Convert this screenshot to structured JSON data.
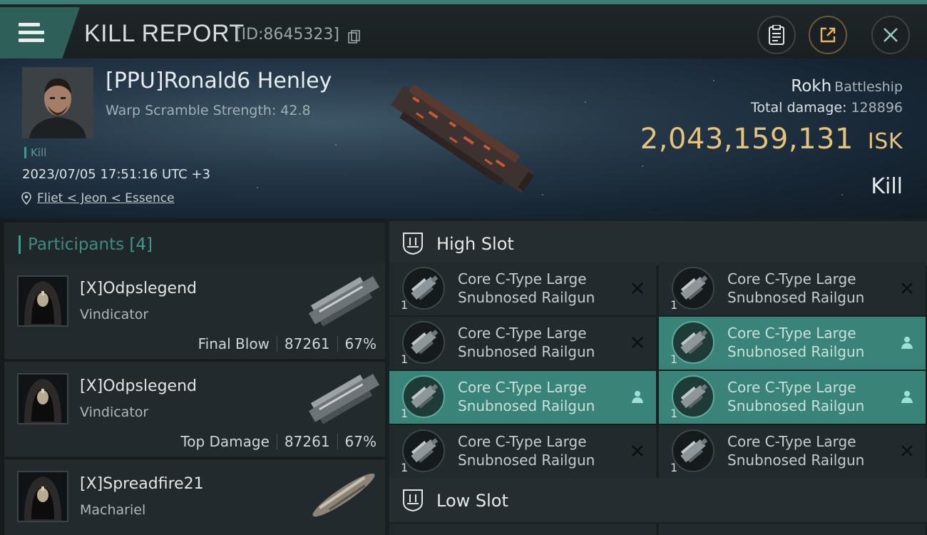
{
  "header": {
    "title": "KILL REPORT",
    "report_id": "[ID:8645323]"
  },
  "victim": {
    "name": "[PPU]Ronald6 Henley",
    "warp_scramble": "Warp Scramble Strength: 42.8",
    "tag": "Kill",
    "datetime": "2023/07/05 17:51:16 UTC +3",
    "location": "Fliet < Jeon < Essence",
    "ship_name": "Rokh",
    "ship_class": "Battleship",
    "damage_label": "Total damage:",
    "damage_value": "128896",
    "isk_value": "2,043,159,131",
    "isk_unit": "ISK",
    "result": "Kill"
  },
  "participants": {
    "title": "Participants",
    "count": "[4]",
    "rows": [
      {
        "name": "[X]Odpslegend",
        "ship": "Vindicator",
        "role": "Final Blow",
        "damage": "87261",
        "percent": "67%"
      },
      {
        "name": "[X]Odpslegend",
        "ship": "Vindicator",
        "role": "Top Damage",
        "damage": "87261",
        "percent": "67%"
      },
      {
        "name": "[X]Spreadfire21",
        "ship": "Machariel",
        "role": "",
        "damage": "",
        "percent": ""
      }
    ]
  },
  "fitting": {
    "high_slot_title": "High Slot",
    "low_slot_title": "Low Slot",
    "high_modules": [
      {
        "line1": "Core C-Type Large",
        "line2": "Snubnosed Railgun",
        "qty": "1",
        "state": "destroyed"
      },
      {
        "line1": "Core C-Type Large",
        "line2": "Snubnosed Railgun",
        "qty": "1",
        "state": "destroyed"
      },
      {
        "line1": "Core C-Type Large",
        "line2": "Snubnosed Railgun",
        "qty": "1",
        "state": "destroyed"
      },
      {
        "line1": "Core C-Type Large",
        "line2": "Snubnosed Railgun",
        "qty": "1",
        "state": "dropped"
      },
      {
        "line1": "Core C-Type Large",
        "line2": "Snubnosed Railgun",
        "qty": "1",
        "state": "dropped"
      },
      {
        "line1": "Core C-Type Large",
        "line2": "Snubnosed Railgun",
        "qty": "1",
        "state": "dropped"
      },
      {
        "line1": "Core C-Type Large",
        "line2": "Snubnosed Railgun",
        "qty": "1",
        "state": "destroyed"
      },
      {
        "line1": "Core C-Type Large",
        "line2": "Snubnosed Railgun",
        "qty": "1",
        "state": "destroyed"
      }
    ]
  },
  "colors": {
    "accent": "#3f9a8c",
    "isk_gold": "#e6c27a",
    "active_module": "#3a8378"
  }
}
